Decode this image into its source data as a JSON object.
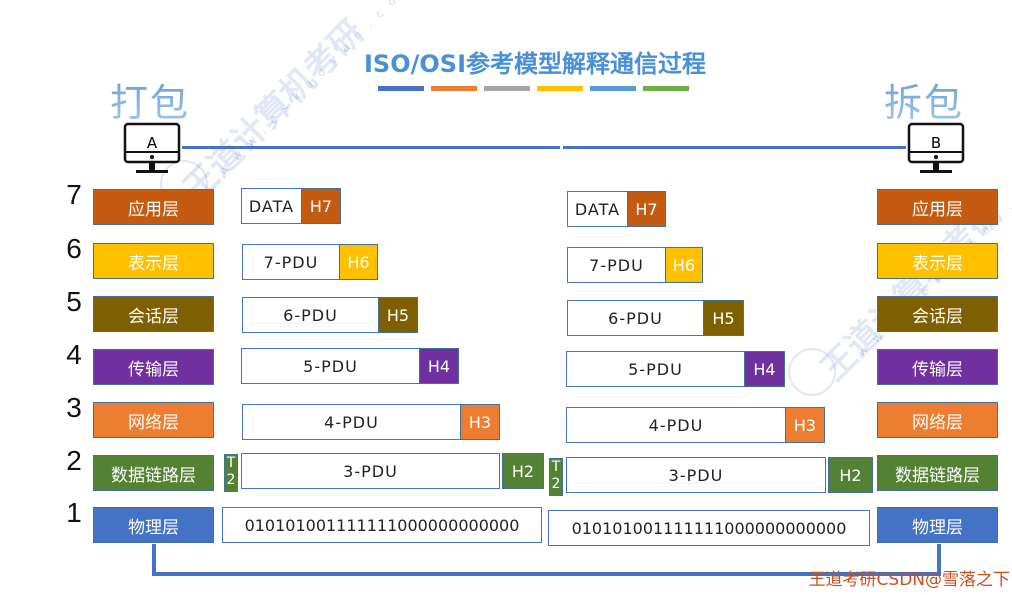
{
  "title": "ISO/OSI参考模型解释通信过程",
  "title_bar_colors": [
    "#4472c4",
    "#ed7d31",
    "#a5a5a5",
    "#ffc000",
    "#5b9bd5",
    "#70ad47"
  ],
  "sender": {
    "heading": "打包",
    "computer_label": "A"
  },
  "receiver": {
    "heading": "拆包",
    "computer_label": "B"
  },
  "layers": [
    {
      "number": "7",
      "name": "应用层",
      "color": "#c55a11"
    },
    {
      "number": "6",
      "name": "表示层",
      "color": "#ffc000"
    },
    {
      "number": "5",
      "name": "会话层",
      "color": "#7f6000"
    },
    {
      "number": "4",
      "name": "传输层",
      "color": "#7030a0"
    },
    {
      "number": "3",
      "name": "网络层",
      "color": "#ed7d31"
    },
    {
      "number": "2",
      "name": "数据链路层",
      "color": "#548235"
    },
    {
      "number": "1",
      "name": "物理层",
      "color": "#4472c4"
    }
  ],
  "sender_units": [
    {
      "payload": "DATA",
      "header": "H7"
    },
    {
      "payload": "7-PDU",
      "header": "H6"
    },
    {
      "payload": "6-PDU",
      "header": "H5"
    },
    {
      "payload": "5-PDU",
      "header": "H4"
    },
    {
      "payload": "4-PDU",
      "header": "H3"
    },
    {
      "payload": "3-PDU",
      "header": "H2",
      "trailer": "T\n2"
    },
    {
      "bits": "010101001111111000000000000"
    }
  ],
  "receiver_units": [
    {
      "payload": "DATA",
      "header": "H7"
    },
    {
      "payload": "7-PDU",
      "header": "H6"
    },
    {
      "payload": "6-PDU",
      "header": "H5"
    },
    {
      "payload": "5-PDU",
      "header": "H4"
    },
    {
      "payload": "4-PDU",
      "header": "H3"
    },
    {
      "payload": "3-PDU",
      "header": "H2",
      "trailer": "T\n2"
    },
    {
      "bits": "010101001111111000000000000"
    }
  ],
  "watermark": {
    "brand": "王道计算机考研",
    "url": "www.cskaoyan.com"
  },
  "footer_mark": "王道考研CSDN@雪落之下"
}
